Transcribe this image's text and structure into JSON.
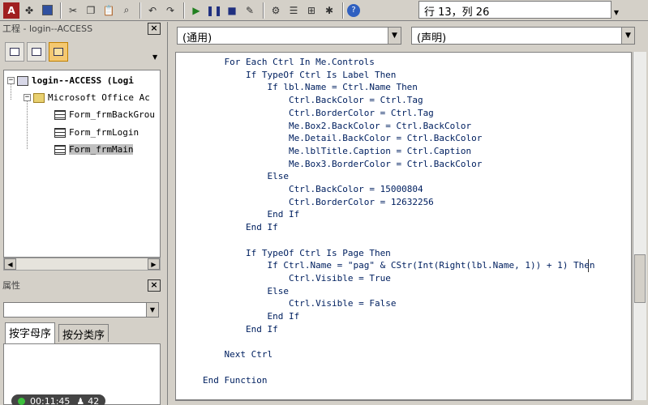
{
  "toolbar": {
    "position_text": "行 13，列 26",
    "buttons": [
      "access-icon",
      "module-icon",
      "save-icon",
      "cut-icon",
      "copy-icon",
      "paste-icon",
      "find-icon",
      "undo-icon",
      "redo-icon",
      "run-icon",
      "pause-icon",
      "stop-icon",
      "design-icon",
      "project-icon",
      "properties-icon",
      "object-browser-icon",
      "toolbox-icon",
      "help-icon"
    ]
  },
  "project": {
    "title": "工程 - login--ACCESS",
    "tree": {
      "root": "login--ACCESS (Logi",
      "folder": "Microsoft Office Ac",
      "items": [
        "Form_frmBackGrou",
        "Form_frmLogin",
        "Form_frmMain"
      ]
    }
  },
  "properties": {
    "title": "属性",
    "tabs": [
      "按字母序",
      "按分类序"
    ]
  },
  "recorder": {
    "time": "00:11:45",
    "count": "42"
  },
  "code": {
    "object_combo": "(通用)",
    "proc_combo": "(声明)",
    "lines": [
      {
        "indent": 1,
        "text": "For Each Ctrl In Me.Controls"
      },
      {
        "indent": 2,
        "text": "If TypeOf Ctrl Is Label Then"
      },
      {
        "indent": 3,
        "text": "If lbl.Name = Ctrl.Name Then"
      },
      {
        "indent": 4,
        "text": "Ctrl.BackColor = Ctrl.Tag"
      },
      {
        "indent": 4,
        "text": "Ctrl.BorderColor = Ctrl.Tag"
      },
      {
        "indent": 4,
        "text": "Me.Box2.BackColor = Ctrl.BackColor"
      },
      {
        "indent": 4,
        "text": "Me.Detail.BackColor = Ctrl.BackColor"
      },
      {
        "indent": 4,
        "text": "Me.lblTitle.Caption = Ctrl.Caption"
      },
      {
        "indent": 4,
        "text": "Me.Box3.BorderColor = Ctrl.BackColor"
      },
      {
        "indent": 3,
        "text": "Else"
      },
      {
        "indent": 4,
        "text": "Ctrl.BackColor = 15000804"
      },
      {
        "indent": 4,
        "text": "Ctrl.BorderColor = 12632256"
      },
      {
        "indent": 3,
        "text": "End If"
      },
      {
        "indent": 2,
        "text": "End If"
      },
      {
        "indent": 0,
        "text": ""
      },
      {
        "indent": 2,
        "text": "If TypeOf Ctrl Is Page Then"
      },
      {
        "indent": 3,
        "text": "If Ctrl.Name = \"pag\" & CStr(Int(Right(lbl.Name, 1)) + 1) Then"
      },
      {
        "indent": 4,
        "text": "Ctrl.Visible = True"
      },
      {
        "indent": 3,
        "text": "Else"
      },
      {
        "indent": 4,
        "text": "Ctrl.Visible = False"
      },
      {
        "indent": 3,
        "text": "End If"
      },
      {
        "indent": 2,
        "text": "End If"
      },
      {
        "indent": 0,
        "text": ""
      },
      {
        "indent": 1,
        "text": "Next Ctrl"
      },
      {
        "indent": 0,
        "text": ""
      },
      {
        "indent": 0,
        "text": "End Function"
      }
    ]
  }
}
